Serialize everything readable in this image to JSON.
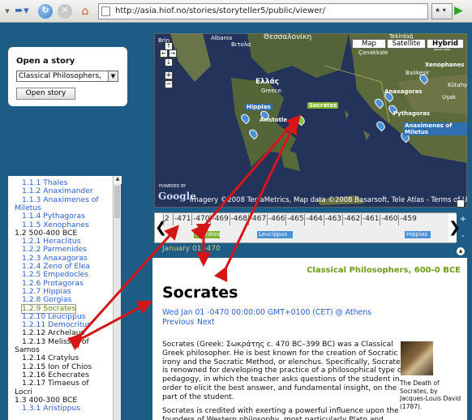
{
  "browser": {
    "url": "http://asia.hiof.no/stories/storyteller5/public/viewer/"
  },
  "story_panel": {
    "title": "Open a story",
    "selected": "Classical Philosophers,",
    "button": "Open story"
  },
  "tree": [
    {
      "text": "1.1.1 Thales",
      "level": 2
    },
    {
      "text": "1.1.2 Anaximander",
      "level": 2
    },
    {
      "text": "1.1.3 Anaximenes of",
      "level": 2
    },
    {
      "text": "Miletus",
      "level": 1,
      "link": true
    },
    {
      "text": "1.1.4 Pythagoras",
      "level": 2
    },
    {
      "text": "1.1.5 Xenophanes",
      "level": 2
    },
    {
      "text": "1.2 500-400 BCE",
      "level": 1
    },
    {
      "text": "1.2.1 Heraclitus",
      "level": 2
    },
    {
      "text": "1.2.2 Parmenides",
      "level": 2
    },
    {
      "text": "1.2.3 Anaxagoras",
      "level": 2
    },
    {
      "text": "1.2.4 Zeno of Elea",
      "level": 2
    },
    {
      "text": "1.2.5 Empedocles",
      "level": 2
    },
    {
      "text": "1.2.6 Protagoras",
      "level": 2
    },
    {
      "text": "1.2.7 Hippias",
      "level": 2
    },
    {
      "text": "1.2.8 Gorgias",
      "level": 2
    },
    {
      "text": "1.2.9 Socrates",
      "level": 2,
      "selected": true
    },
    {
      "text": "1.2.10 Leucippus",
      "level": 2
    },
    {
      "text": "1.2.11 Democritus",
      "level": 2
    },
    {
      "text": "1.2.12 Archelaus",
      "level": 2,
      "dark": true
    },
    {
      "text": "1.2.13 Melissus of",
      "level": 2,
      "dark": true
    },
    {
      "text": "Samos",
      "level": 1
    },
    {
      "text": "1.2.14 Cratylus",
      "level": 2,
      "dark": true
    },
    {
      "text": "1.2.15 Ion of Chios",
      "level": 2,
      "dark": true
    },
    {
      "text": "1.2.16 Echecrates",
      "level": 2,
      "dark": true
    },
    {
      "text": "1.2.17 Timaeus of",
      "level": 2,
      "dark": true
    },
    {
      "text": "Locri",
      "level": 1
    },
    {
      "text": "1.3 400-300 BCE",
      "level": 1
    },
    {
      "text": "1.3.1 Aristippus",
      "level": 2
    }
  ],
  "map": {
    "buttons": [
      "Map",
      "Satellite",
      "Hybrid"
    ],
    "places": [
      "Albania",
      "Βιτολα",
      "Θεσσαλονίκη",
      "Ελλάς",
      "Greece",
      "Tekirdağ",
      "Çanakkale",
      "Bursa",
      "Balıkesir",
      "Kütahy",
      "Uşak",
      "Brin"
    ],
    "markers": [
      "Socrates",
      "Hippias",
      "Aristotle",
      "Xenophanes",
      "Anaxagoras",
      "Pythagoras",
      "Anaximenes of Miletus"
    ],
    "powered_by": "POWERED BY",
    "google": "Google",
    "copyright": "Imagery ©2008 TerraMetrics, Map data ©2008 Basarsoft, Tele Atlas - Terms of Use"
  },
  "timeline": {
    "ticks": [
      "-471",
      "-470",
      "-469",
      "-468",
      "-467",
      "-466",
      "-465",
      "-464",
      "-463",
      "-462",
      "-461",
      "-460",
      "-459"
    ],
    "leading": "2",
    "bars": [
      "Socrates",
      "Leucippus",
      "Hippias"
    ],
    "date": "January 01 -470",
    "zoom_in": "+",
    "zoom_out": "-"
  },
  "article": {
    "breadcrumb": "Classical Philosophers, 600-0 BCE",
    "title": "Socrates",
    "date": "Wed Jan 01 -0470 00:00:00 GMT+0100 (CET) @ Athens",
    "prev": "Previous",
    "next": "Next",
    "para1_lines": [
      "Socrates (Greek: Σωκράτης c. 470 BC–399 BC) was a Classical",
      "Greek philosopher. He is best known for the creation of Socratic",
      "irony and the Socratic Method, or elenchus. Specifically, Socrates",
      "is renowned for developing the practice of a philosophical type of",
      "pedagogy, in which the teacher asks questions of the student in",
      "order to elicit the best answer, and fundamental insight, on the",
      "part of the student."
    ],
    "para2_lines": [
      "Socrates is credited with exerting a powerful influence upon the",
      "founders of Western philosophy, most particularly Plato and"
    ],
    "caption_lines": [
      "The Death of",
      "Socrates, by",
      "Jacques-Louis David",
      "(1787)."
    ]
  }
}
